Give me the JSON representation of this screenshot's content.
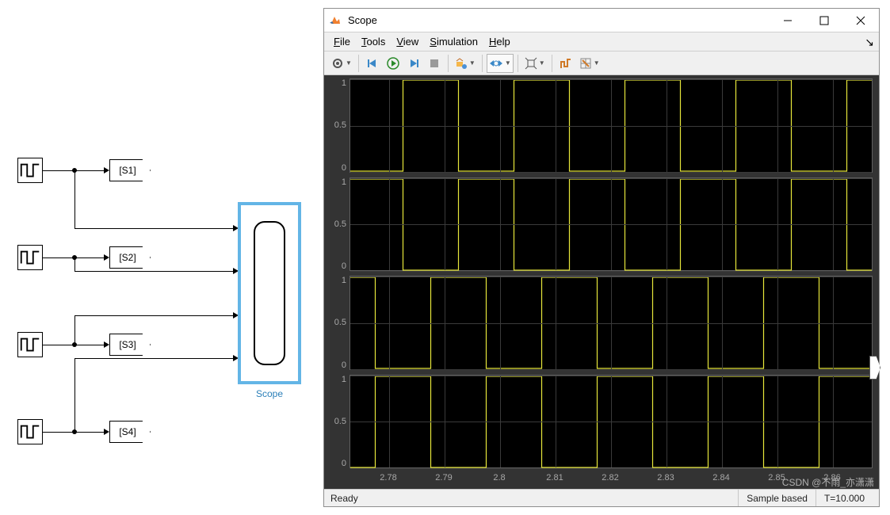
{
  "diagram": {
    "goto_labels": [
      "[S1]",
      "[S2]",
      "[S3]",
      "[S4]"
    ],
    "scope_label": "Scope"
  },
  "scope_window": {
    "title": "Scope",
    "menus": {
      "file": "File",
      "tools": "Tools",
      "view": "View",
      "simulation": "Simulation",
      "help": "Help"
    },
    "statusbar": {
      "ready": "Ready",
      "sample": "Sample based",
      "time": "T=10.000"
    }
  },
  "chart_data": [
    {
      "type": "line",
      "kind": "square",
      "ylim": [
        0,
        1
      ],
      "yticks": [
        0,
        0.5,
        1
      ],
      "period": 0.02,
      "duty": 0.5,
      "phase": 0.0025,
      "high": 1,
      "low": 0
    },
    {
      "type": "line",
      "kind": "square",
      "ylim": [
        0,
        1
      ],
      "yticks": [
        0,
        0.5,
        1
      ],
      "period": 0.02,
      "duty": 0.5,
      "phase": -0.0075,
      "high": 1,
      "low": 0
    },
    {
      "type": "line",
      "kind": "square",
      "ylim": [
        0,
        1
      ],
      "yticks": [
        0,
        0.5,
        1
      ],
      "period": 0.02,
      "duty": 0.5,
      "phase": 0.0075,
      "high": 1,
      "low": 0
    },
    {
      "type": "line",
      "kind": "square",
      "ylim": [
        0,
        1
      ],
      "yticks": [
        0,
        0.5,
        1
      ],
      "period": 0.02,
      "duty": 0.5,
      "phase": -0.0025,
      "high": 1,
      "low": 0
    }
  ],
  "x_axis": {
    "min": 2.773,
    "max": 2.867,
    "ticks": [
      2.78,
      2.79,
      2.8,
      2.81,
      2.82,
      2.83,
      2.84,
      2.85,
      2.86
    ]
  },
  "watermark": "CSDN @不雨_亦潇潇"
}
